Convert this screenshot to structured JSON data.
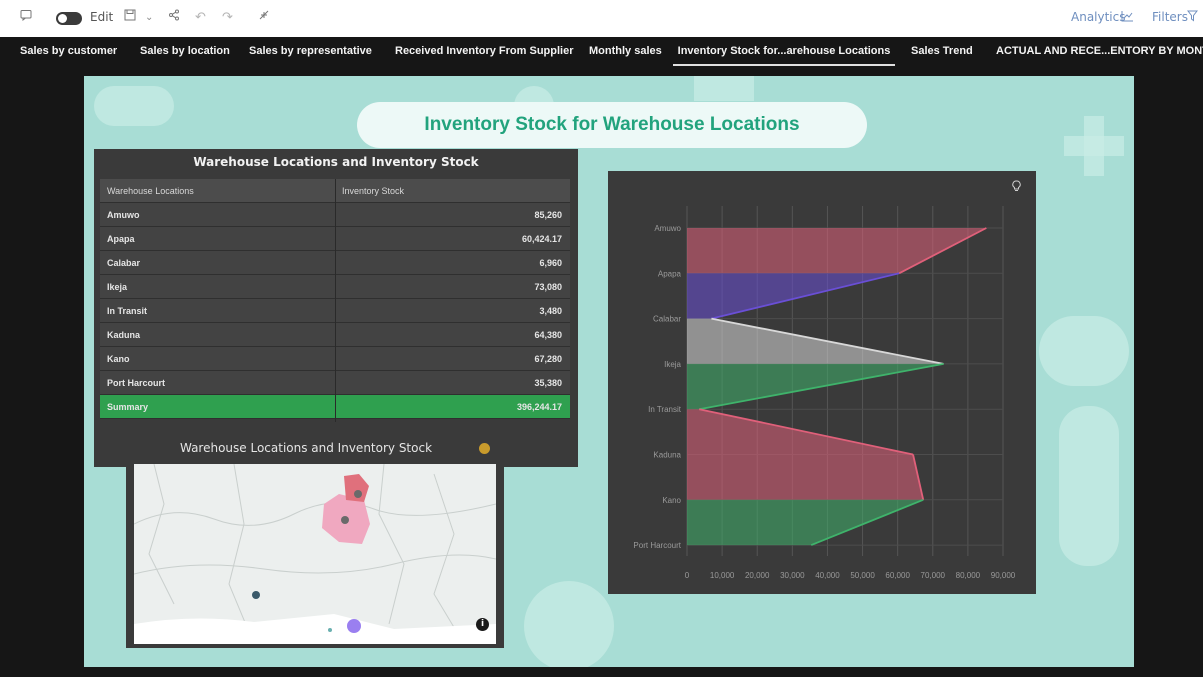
{
  "toolbar": {
    "edit_label": "Edit",
    "analytics_label": "Analytics",
    "filters_label": "Filters"
  },
  "tabs": [
    {
      "label": "Sales by customer"
    },
    {
      "label": "Sales by location"
    },
    {
      "label": "Sales by representative"
    },
    {
      "label": "Received Inventory From Supplier"
    },
    {
      "label": "Monthly sales"
    },
    {
      "label": "Inventory Stock for...arehouse Locations"
    },
    {
      "label": "Sales Trend"
    },
    {
      "label": "ACTUAL AND RECE...ENTORY BY MONTH"
    }
  ],
  "active_tab": "Inventory Stock for...arehouse Locations",
  "page": {
    "title": "Inventory Stock for Warehouse Locations"
  },
  "table": {
    "title": "Warehouse Locations and Inventory Stock",
    "headers": [
      "Warehouse Locations",
      "Inventory Stock"
    ],
    "rows": [
      {
        "location": "Amuwo",
        "stock": "85,260"
      },
      {
        "location": "Apapa",
        "stock": "60,424.17"
      },
      {
        "location": "Calabar",
        "stock": "6,960"
      },
      {
        "location": "Ikeja",
        "stock": "73,080"
      },
      {
        "location": "In Transit",
        "stock": "3,480"
      },
      {
        "location": "Kaduna",
        "stock": "64,380"
      },
      {
        "location": "Kano",
        "stock": "67,280"
      },
      {
        "location": "Port Harcourt",
        "stock": "35,380"
      }
    ],
    "summary": {
      "label": "Summary",
      "value": "396,244.17"
    }
  },
  "map": {
    "title": "Warehouse Locations and Inventory Stock"
  },
  "colors": {
    "accent_green": "#22a37d",
    "summary_green": "#2fa04f",
    "panel_bg": "#3a3a3a",
    "canvas_bg": "#a8ddd5"
  },
  "chart_data": {
    "type": "area",
    "orientation": "horizontal",
    "categories": [
      "Amuwo",
      "Apapa",
      "Calabar",
      "Ikeja",
      "In Transit",
      "Kaduna",
      "Kano",
      "Port Harcourt"
    ],
    "values": [
      85260,
      60424.17,
      6960,
      73080,
      3480,
      64380,
      67280,
      35380
    ],
    "x_ticks": [
      "0",
      "10,000",
      "20,000",
      "30,000",
      "40,000",
      "50,000",
      "60,000",
      "70,000",
      "80,000",
      "90,000"
    ],
    "xlim": [
      0,
      90000
    ],
    "grid": true,
    "segment_colors": [
      "#e0607a",
      "#6a4fd6",
      "#d8d8d8",
      "#3fb36b",
      "#e0607a",
      "#e0607a",
      "#3fb36b"
    ]
  }
}
